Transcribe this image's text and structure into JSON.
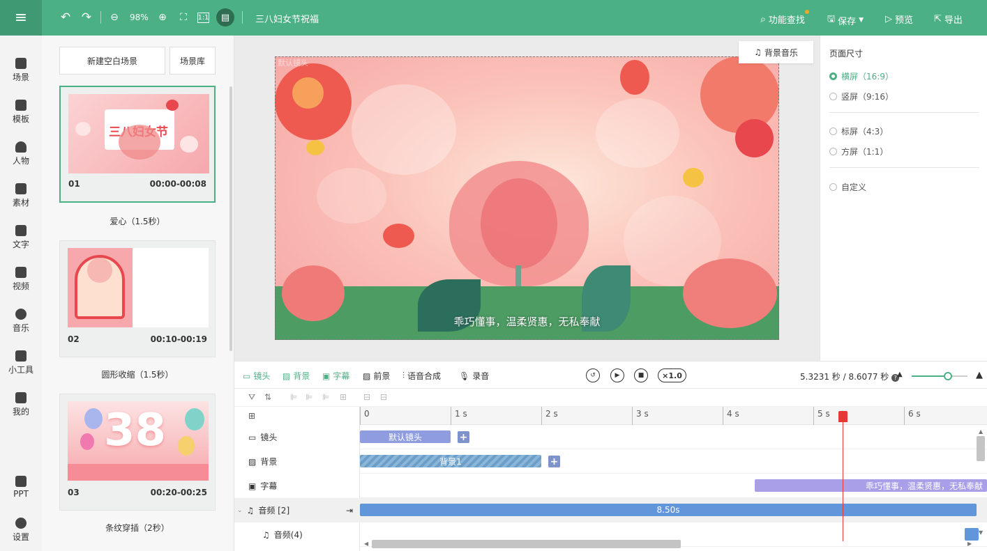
{
  "toolbar": {
    "zoom": "98%",
    "doc_title": "三八妇女节祝福",
    "find_label": "功能查找",
    "save_label": "保存",
    "preview_label": "预览",
    "export_label": "导出"
  },
  "nav": [
    {
      "label": "场景",
      "icon": "scene-icon"
    },
    {
      "label": "模板",
      "icon": "template-icon"
    },
    {
      "label": "人物",
      "icon": "person-icon"
    },
    {
      "label": "素材",
      "icon": "material-icon"
    },
    {
      "label": "文字",
      "icon": "text-icon"
    },
    {
      "label": "视频",
      "icon": "video-icon"
    },
    {
      "label": "音乐",
      "icon": "music-icon"
    },
    {
      "label": "小工具",
      "icon": "toolbox-icon"
    },
    {
      "label": "我的",
      "icon": "upload-icon"
    },
    {
      "label": "PPT",
      "icon": "ppt-icon"
    },
    {
      "label": "设置",
      "icon": "gear-icon"
    }
  ],
  "scenes_panel": {
    "new_blank": "新建空白场景",
    "library": "场景库",
    "scenes": [
      {
        "num": "01",
        "time": "00:00-00:08",
        "name": "爱心（1.5秒）",
        "thumb_title": "三八妇女节",
        "selected": true
      },
      {
        "num": "02",
        "time": "00:10-00:19",
        "name": "圆形收缩（1.5秒）",
        "selected": false
      },
      {
        "num": "03",
        "time": "00:20-00:25",
        "name": "条纹穿插（2秒）",
        "thumb_title": "38",
        "selected": false
      }
    ]
  },
  "canvas": {
    "bgm_label": "背景音乐",
    "subtitle": "乖巧懂事，温柔贤惠，无私奉献",
    "corner_label": "默认镜头"
  },
  "right_panel": {
    "title": "页面尺寸",
    "options": [
      {
        "label": "横屏（16:9）",
        "selected": true
      },
      {
        "label": "竖屏（9:16）",
        "selected": false
      },
      {
        "label": "标屏（4:3）",
        "selected": false
      },
      {
        "label": "方屏（1:1）",
        "selected": false
      },
      {
        "label": "自定义",
        "selected": false
      }
    ]
  },
  "timeline": {
    "tabs": [
      {
        "label": "镜头",
        "active": true
      },
      {
        "label": "背景",
        "active": true
      },
      {
        "label": "字幕",
        "active": true
      },
      {
        "label": "前景",
        "active": false
      },
      {
        "label": "语音合成",
        "active": false
      },
      {
        "label": "录音",
        "active": false
      }
    ],
    "speed": "×1.0",
    "time_info": "5.3231 秒 / 8.6077 秒",
    "zoom_fraction": 0.65,
    "ruler": [
      "0",
      "1 s",
      "2 s",
      "3 s",
      "4 s",
      "5 s",
      "6 s"
    ],
    "rows": [
      {
        "label": "镜头",
        "icon": "camera-icon"
      },
      {
        "label": "背景",
        "icon": "background-icon"
      },
      {
        "label": "字幕",
        "icon": "caption-icon"
      },
      {
        "label": "音频 [2]",
        "icon": "audio-icon"
      },
      {
        "label": "音频(4)",
        "icon": "music-note-icon"
      }
    ],
    "clips": {
      "camera": "默认镜头",
      "background": "背景1",
      "caption": "乖巧懂事，温柔贤惠，无私奉献",
      "audio": "8.50s"
    },
    "playhead_seconds": 5.3231,
    "colors": {
      "camera": "#8f9de0",
      "background": "#6b9fc9",
      "caption": "#a99ee8",
      "audio": "#6196db",
      "accent": "#4cb085"
    }
  }
}
